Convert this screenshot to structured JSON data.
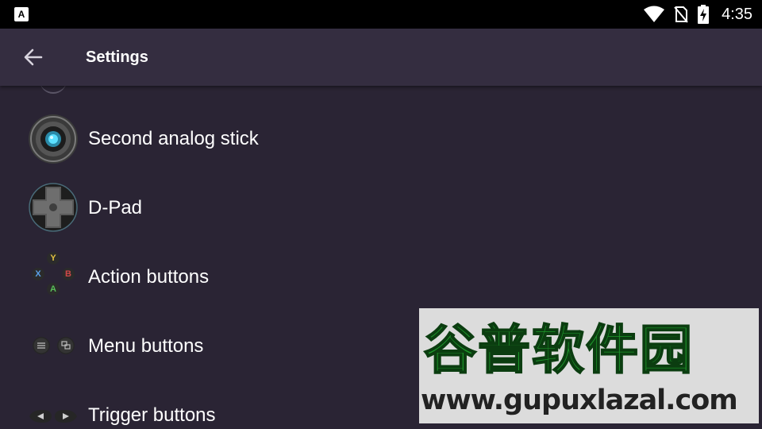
{
  "status_bar": {
    "app_icon_letter": "A",
    "time": "4:35",
    "icons": [
      "wifi-icon",
      "no-sim-icon",
      "battery-charging-icon"
    ]
  },
  "app_bar": {
    "back_icon": "arrow-back-icon",
    "title": "Settings"
  },
  "list": {
    "items": [
      {
        "label": "Second analog stick",
        "icon": "analog-stick-icon"
      },
      {
        "label": "D-Pad",
        "icon": "dpad-icon"
      },
      {
        "label": "Action buttons",
        "icon": "action-buttons-icon"
      },
      {
        "label": "Menu buttons",
        "icon": "menu-buttons-icon"
      },
      {
        "label": "Trigger buttons",
        "icon": "trigger-buttons-icon"
      }
    ],
    "action_button_letters": [
      "Y",
      "X",
      "B",
      "A"
    ]
  },
  "watermark": {
    "chinese": "谷普软件园",
    "url": "www.gupuxlazal.com"
  },
  "colors": {
    "background": "#2a2434",
    "app_bar": "#342d40",
    "status_bar": "#000000",
    "watermark_green": "#1e9a2c"
  }
}
